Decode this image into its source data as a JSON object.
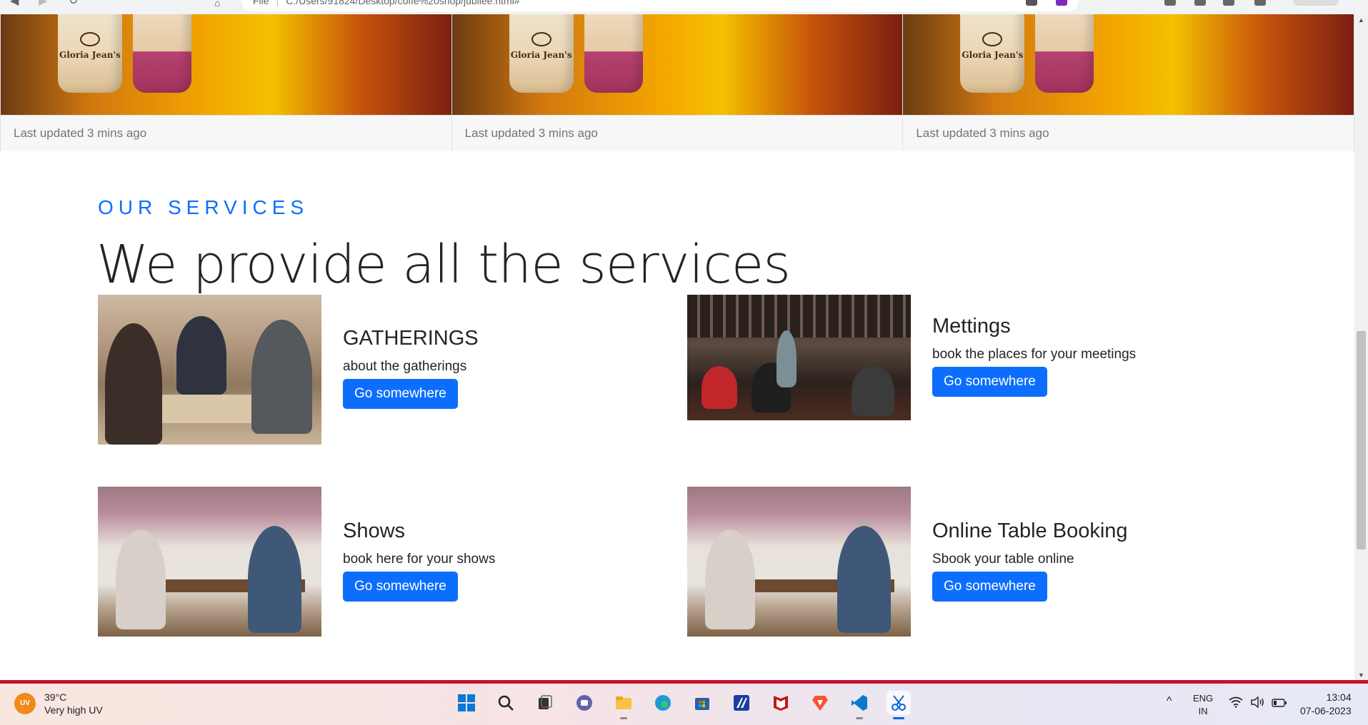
{
  "browser": {
    "address_prefix": "File",
    "address_url": "C:/Users/91824/Desktop/coffe%20shop/jubilee.html#"
  },
  "cards": [
    {
      "footer": "Last updated 3 mins ago",
      "brand": "Gloria Jean's"
    },
    {
      "footer": "Last updated 3 mins ago",
      "brand": "Gloria Jean's"
    },
    {
      "footer": "Last updated 3 mins ago",
      "brand": "Gloria Jean's"
    }
  ],
  "services": {
    "tag": "OUR SERVICES",
    "heading": "We provide all the services",
    "items": [
      {
        "title": "GATHERINGS",
        "text": "about the gatherings",
        "button": "Go somewhere"
      },
      {
        "title": "Mettings",
        "text": "book the places for your meetings",
        "button": "Go somewhere"
      },
      {
        "title": "Shows",
        "text": "book here for your shows",
        "button": "Go somewhere"
      },
      {
        "title": "Online Table Booking",
        "text": "Sbook your table online",
        "button": "Go somewhere"
      }
    ]
  },
  "taskbar": {
    "weather_badge": "UV",
    "temperature": "39°C",
    "weather_desc": "Very high UV",
    "icons": [
      "windows-start-icon",
      "search-icon",
      "task-view-icon",
      "teams-chat-icon",
      "file-explorer-icon",
      "edge-browser-icon",
      "microsoft-store-icon",
      "app-icon",
      "mcafee-icon",
      "brave-browser-icon",
      "vscode-icon",
      "snipping-tool-icon"
    ],
    "lang_top": "ENG",
    "lang_bottom": "IN",
    "time": "13:04",
    "date": "07-06-2023"
  },
  "colors": {
    "primary": "#0d6efd",
    "taskbar_accent": "#c8102e"
  }
}
